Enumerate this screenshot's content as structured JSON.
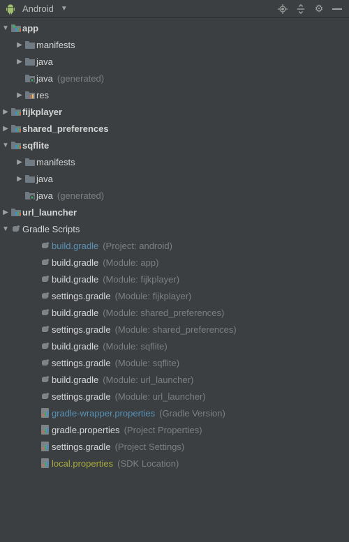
{
  "topbar": {
    "view_label": "Android"
  },
  "tree": [
    {
      "depth": 0,
      "arrow": "down",
      "icon": "module-app",
      "label": "app",
      "bold": true
    },
    {
      "depth": 1,
      "arrow": "right",
      "icon": "folder",
      "label": "manifests"
    },
    {
      "depth": 1,
      "arrow": "right",
      "icon": "folder",
      "label": "java"
    },
    {
      "depth": 1,
      "arrow": "none",
      "icon": "folder-gen",
      "label": "java",
      "hint": "(generated)"
    },
    {
      "depth": 1,
      "arrow": "right",
      "icon": "folder-res",
      "label": "res"
    },
    {
      "depth": 0,
      "arrow": "right",
      "icon": "module",
      "label": "fijkplayer",
      "bold": true
    },
    {
      "depth": 0,
      "arrow": "right",
      "icon": "module",
      "label": "shared_preferences",
      "bold": true
    },
    {
      "depth": 0,
      "arrow": "down",
      "icon": "module",
      "label": "sqflite",
      "bold": true
    },
    {
      "depth": 1,
      "arrow": "right",
      "icon": "folder",
      "label": "manifests"
    },
    {
      "depth": 1,
      "arrow": "right",
      "icon": "folder",
      "label": "java"
    },
    {
      "depth": 1,
      "arrow": "none",
      "icon": "folder-gen",
      "label": "java",
      "hint": "(generated)"
    },
    {
      "depth": 0,
      "arrow": "right",
      "icon": "module",
      "label": "url_launcher",
      "bold": true
    },
    {
      "depth": 0,
      "arrow": "down",
      "icon": "gradle",
      "label": "Gradle Scripts"
    },
    {
      "depth": 2,
      "arrow": "none",
      "icon": "gradle",
      "label": "build.gradle",
      "labelClass": "link",
      "hint": "(Project: android)"
    },
    {
      "depth": 2,
      "arrow": "none",
      "icon": "gradle",
      "label": "build.gradle",
      "hint": "(Module: app)"
    },
    {
      "depth": 2,
      "arrow": "none",
      "icon": "gradle",
      "label": "build.gradle",
      "hint": "(Module: fijkplayer)"
    },
    {
      "depth": 2,
      "arrow": "none",
      "icon": "gradle",
      "label": "settings.gradle",
      "hint": "(Module: fijkplayer)"
    },
    {
      "depth": 2,
      "arrow": "none",
      "icon": "gradle",
      "label": "build.gradle",
      "hint": "(Module: shared_preferences)"
    },
    {
      "depth": 2,
      "arrow": "none",
      "icon": "gradle",
      "label": "settings.gradle",
      "hint": "(Module: shared_preferences)"
    },
    {
      "depth": 2,
      "arrow": "none",
      "icon": "gradle",
      "label": "build.gradle",
      "hint": "(Module: sqflite)"
    },
    {
      "depth": 2,
      "arrow": "none",
      "icon": "gradle",
      "label": "settings.gradle",
      "hint": "(Module: sqflite)"
    },
    {
      "depth": 2,
      "arrow": "none",
      "icon": "gradle",
      "label": "build.gradle",
      "hint": "(Module: url_launcher)"
    },
    {
      "depth": 2,
      "arrow": "none",
      "icon": "gradle",
      "label": "settings.gradle",
      "hint": "(Module: url_launcher)"
    },
    {
      "depth": 2,
      "arrow": "none",
      "icon": "props",
      "label": "gradle-wrapper.properties",
      "labelClass": "link",
      "hint": "(Gradle Version)"
    },
    {
      "depth": 2,
      "arrow": "none",
      "icon": "props",
      "label": "gradle.properties",
      "hint": "(Project Properties)"
    },
    {
      "depth": 2,
      "arrow": "none",
      "icon": "props",
      "label": "settings.gradle",
      "hint": "(Project Settings)"
    },
    {
      "depth": 2,
      "arrow": "none",
      "icon": "props",
      "label": "local.properties",
      "labelClass": "olive",
      "hint": "(SDK Location)"
    }
  ]
}
